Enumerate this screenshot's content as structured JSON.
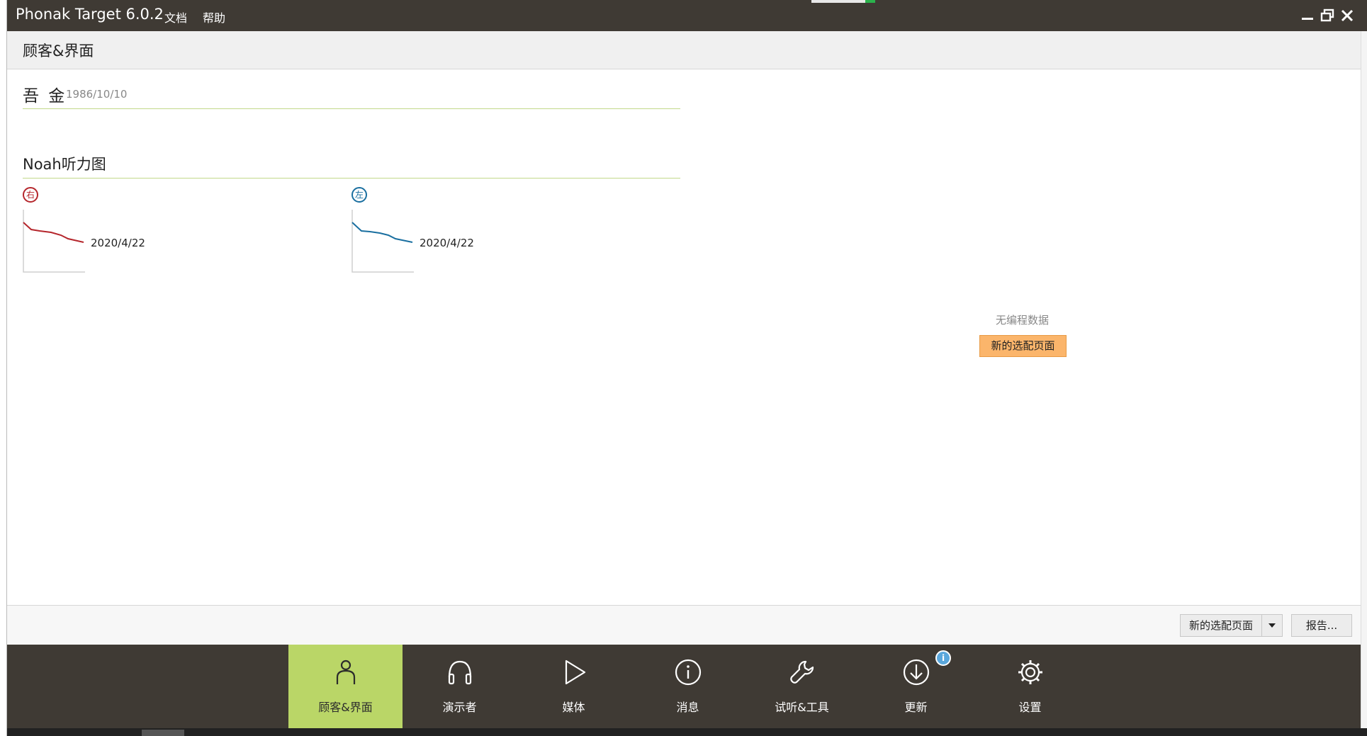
{
  "app": {
    "title": "Phonak Target 6.0.2",
    "menu": [
      "文档",
      "帮助"
    ]
  },
  "page": {
    "title": "顾客&界面"
  },
  "client": {
    "name": "吾 金",
    "dob": "1986/10/10"
  },
  "audiogram": {
    "section_title": "Noah听力图",
    "right": {
      "badge": "右",
      "date": "2020/4/22",
      "color": "#b5262c"
    },
    "left": {
      "badge": "左",
      "date": "2020/4/22",
      "color": "#1a6fa0"
    }
  },
  "session_panel": {
    "no_data": "无编程数据",
    "new_session_button": "新的选配页面"
  },
  "action_bar": {
    "new_session_split": "新的选配页面",
    "report_button": "报告..."
  },
  "nav": {
    "items": [
      {
        "label": "顾客&界面",
        "icon": "person-icon",
        "active": true
      },
      {
        "label": "演示者",
        "icon": "headphones-icon"
      },
      {
        "label": "媒体",
        "icon": "play-icon"
      },
      {
        "label": "消息",
        "icon": "info-icon"
      },
      {
        "label": "试听&工具",
        "icon": "wrench-icon"
      },
      {
        "label": "更新",
        "icon": "download-icon",
        "badge": "i"
      },
      {
        "label": "设置",
        "icon": "gear-icon"
      }
    ]
  }
}
